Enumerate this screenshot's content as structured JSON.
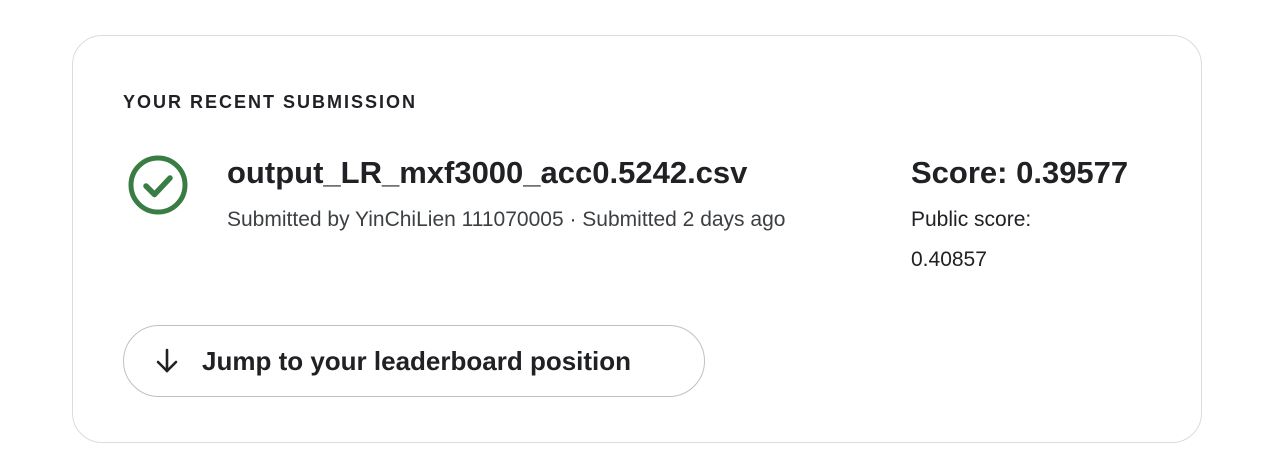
{
  "card": {
    "section_label": "YOUR RECENT SUBMISSION",
    "status_icon": "check-circle-icon",
    "status_color": "#3a7d44",
    "file_name": "output_LR_mxf3000_acc0.5242.csv",
    "submitted_meta": "Submitted by YinChiLien 111070005 · Submitted 2 days ago",
    "score": "Score: 0.39577",
    "public_score": "Public score: 0.40857",
    "jump_button": {
      "label": "Jump to your leaderboard position",
      "icon": "arrow-down-icon"
    }
  }
}
